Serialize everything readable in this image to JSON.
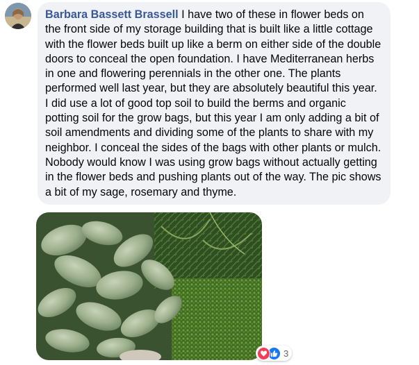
{
  "comment": {
    "author": "Barbara Bassett Brassell",
    "text": "I have two of these in flower beds on the front side of my storage building that is built like a little cottage with the flower beds built up like a berm on either side of the double doors to conceal the open foundation. I have Mediterranean herbs in one and flowering perennials in the other one. The plants performed well last year, but they are absolutely beautiful this year. I did use a lot of good top soil to build the berms and organic potting soil for the grow bags, but this year I am only adding a bit of soil amendments and dividing some of the plants to share with my neighbor. I conceal the sides of the bags with other plants or mulch. Nobody would know I was using grow bags without actually getting in the flower beds and pushing plants out of the way. The pic shows a bit of my sage, rosemary and thyme."
  },
  "reactions": {
    "icons": [
      "love-icon",
      "like-icon"
    ],
    "count": "3"
  },
  "colors": {
    "author": "#385898",
    "bubble": "#f0f2f5",
    "love": "#f33e58",
    "like": "#1877f2"
  }
}
